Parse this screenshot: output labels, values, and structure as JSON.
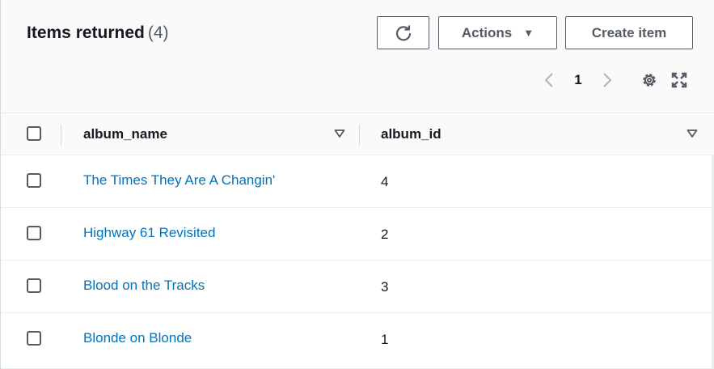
{
  "header": {
    "title": "Items returned",
    "count": "(4)"
  },
  "toolbar": {
    "refresh_icon": "refresh-icon",
    "actions_label": "Actions",
    "create_label": "Create item"
  },
  "pagination": {
    "current_page": "1",
    "prev_icon": "chevron-left-icon",
    "next_icon": "chevron-right-icon"
  },
  "tools": {
    "settings_icon": "gear-icon",
    "fullscreen_icon": "expand-icon"
  },
  "table": {
    "columns": [
      {
        "label": "album_name"
      },
      {
        "label": "album_id"
      }
    ],
    "rows": [
      {
        "album_name": "The Times They Are A Changin'",
        "album_id": "4"
      },
      {
        "album_name": "Highway 61 Revisited",
        "album_id": "2"
      },
      {
        "album_name": "Blood on the Tracks",
        "album_id": "3"
      },
      {
        "album_name": "Blonde on Blonde",
        "album_id": "1"
      }
    ]
  },
  "colors": {
    "link": "#0073bb",
    "text": "#16191f",
    "header_bg": "#fafafa",
    "border": "#eaeded"
  }
}
